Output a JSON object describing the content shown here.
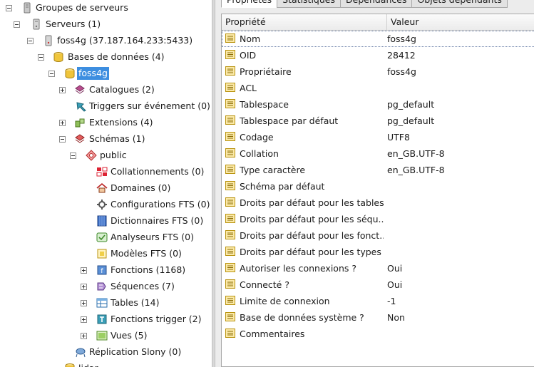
{
  "tree": {
    "items": [
      {
        "label": "Groupes de serveurs",
        "icon": "server-group-icon",
        "expander": "minus"
      },
      {
        "label": "Serveurs (1)",
        "icon": "servers-icon",
        "expander": "minus"
      },
      {
        "label": "foss4g (37.187.164.233:5433)",
        "icon": "server-icon",
        "expander": "minus"
      },
      {
        "label": "Bases de données (4)",
        "icon": "databases-icon",
        "expander": "minus"
      },
      {
        "label": "foss4g",
        "icon": "database-icon",
        "expander": "minus",
        "selected": true
      },
      {
        "label": "Catalogues (2)",
        "icon": "catalogs-icon",
        "expander": "plus"
      },
      {
        "label": "Triggers sur événement (0)",
        "icon": "event-trigger-icon",
        "expander": "none"
      },
      {
        "label": "Extensions (4)",
        "icon": "extensions-icon",
        "expander": "plus"
      },
      {
        "label": "Schémas (1)",
        "icon": "schemas-icon",
        "expander": "minus"
      },
      {
        "label": "public",
        "icon": "schema-icon",
        "expander": "minus"
      },
      {
        "label": "Collationnements (0)",
        "icon": "collation-icon",
        "expander": "none"
      },
      {
        "label": "Domaines (0)",
        "icon": "domain-icon",
        "expander": "none"
      },
      {
        "label": "Configurations FTS (0)",
        "icon": "fts-config-icon",
        "expander": "none"
      },
      {
        "label": "Dictionnaires FTS (0)",
        "icon": "fts-dictionary-icon",
        "expander": "none"
      },
      {
        "label": "Analyseurs FTS (0)",
        "icon": "fts-parser-icon",
        "expander": "none"
      },
      {
        "label": "Modèles FTS (0)",
        "icon": "fts-template-icon",
        "expander": "none"
      },
      {
        "label": "Fonctions (1168)",
        "icon": "functions-icon",
        "expander": "plus"
      },
      {
        "label": "Séquences (7)",
        "icon": "sequences-icon",
        "expander": "plus"
      },
      {
        "label": "Tables (14)",
        "icon": "tables-icon",
        "expander": "plus"
      },
      {
        "label": "Fonctions trigger (2)",
        "icon": "trigger-functions-icon",
        "expander": "plus"
      },
      {
        "label": "Vues (5)",
        "icon": "views-icon",
        "expander": "plus"
      },
      {
        "label": "Réplication Slony (0)",
        "icon": "slony-icon",
        "expander": "none"
      },
      {
        "label": "lidar",
        "icon": "database-icon",
        "expander": "none"
      }
    ]
  },
  "tabs": [
    {
      "label": "Propriétés",
      "active": true
    },
    {
      "label": "Statistiques",
      "active": false
    },
    {
      "label": "Dépendances",
      "active": false
    },
    {
      "label": "Objets dépendants",
      "active": false
    }
  ],
  "properties": {
    "headers": {
      "property": "Propriété",
      "value": "Valeur"
    },
    "rows": [
      {
        "name": "Nom",
        "value": "foss4g"
      },
      {
        "name": "OID",
        "value": "28412"
      },
      {
        "name": "Propriétaire",
        "value": "foss4g"
      },
      {
        "name": "ACL",
        "value": ""
      },
      {
        "name": "Tablespace",
        "value": "pg_default"
      },
      {
        "name": "Tablespace par défaut",
        "value": "pg_default"
      },
      {
        "name": "Codage",
        "value": "UTF8"
      },
      {
        "name": "Collation",
        "value": "en_GB.UTF-8"
      },
      {
        "name": "Type caractère",
        "value": "en_GB.UTF-8"
      },
      {
        "name": "Schéma par défaut",
        "value": ""
      },
      {
        "name": "Droits par défaut pour les tables",
        "value": ""
      },
      {
        "name": "Droits par défaut pour les séqu...",
        "value": ""
      },
      {
        "name": "Droits par défaut pour les fonct...",
        "value": ""
      },
      {
        "name": "Droits par défaut pour les types",
        "value": ""
      },
      {
        "name": "Autoriser les connexions ?",
        "value": "Oui"
      },
      {
        "name": "Connecté ?",
        "value": "Oui"
      },
      {
        "name": "Limite de connexion",
        "value": "-1"
      },
      {
        "name": "Base de données système ?",
        "value": "Non"
      },
      {
        "name": "Commentaires",
        "value": ""
      }
    ]
  },
  "colors": {
    "selection": "#3d8ee0",
    "property_icon": "#e0b92e"
  }
}
